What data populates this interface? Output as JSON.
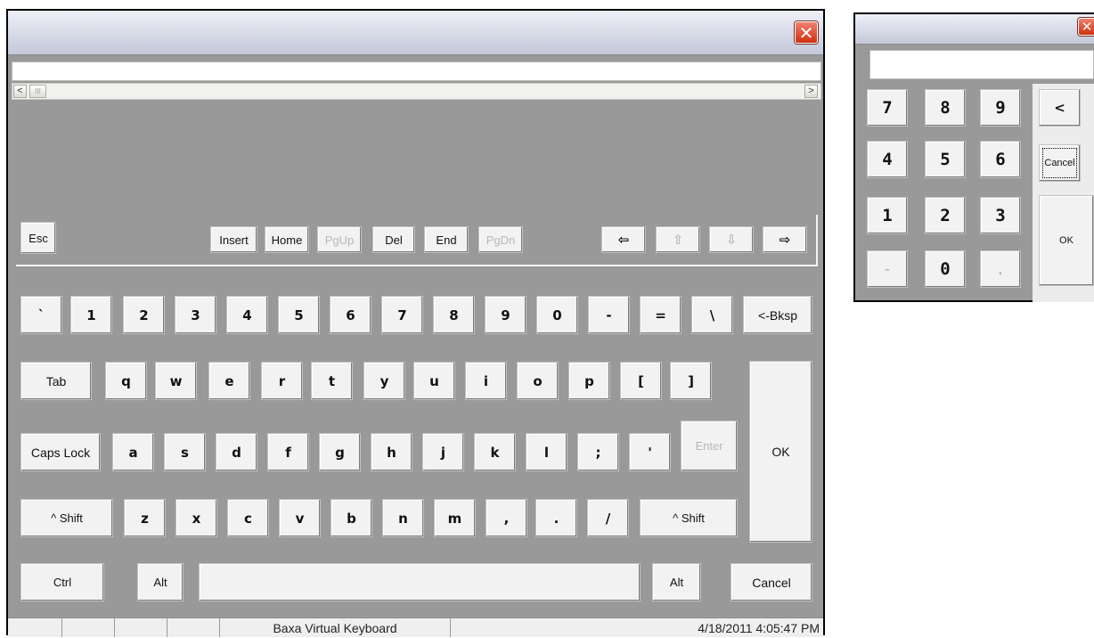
{
  "keyboard": {
    "close_icon": "close-x-icon",
    "text_value": "",
    "scroll_left": "<",
    "scroll_right": ">",
    "scroll_thumb": "III",
    "nav": {
      "esc": "Esc",
      "insert": "Insert",
      "home": "Home",
      "pgup": "PgUp",
      "del": "Del",
      "end": "End",
      "pgdn": "PgDn",
      "arrow_left": "⇦",
      "arrow_up": "⇧",
      "arrow_down": "⇩",
      "arrow_right": "⇨"
    },
    "row1": [
      "`",
      "1",
      "2",
      "3",
      "4",
      "5",
      "6",
      "7",
      "8",
      "9",
      "0",
      "-",
      "=",
      "\\",
      "<-Bksp"
    ],
    "row2": [
      "Tab",
      "q",
      "w",
      "e",
      "r",
      "t",
      "y",
      "u",
      "i",
      "o",
      "p",
      "[",
      "]"
    ],
    "row3": [
      "Caps Lock",
      "a",
      "s",
      "d",
      "f",
      "g",
      "h",
      "j",
      "k",
      "l",
      ";",
      "'",
      "Enter"
    ],
    "row4": [
      "^ Shift",
      "z",
      "x",
      "c",
      "v",
      "b",
      "n",
      "m",
      ",",
      ".",
      "/",
      "^ Shift"
    ],
    "row5": {
      "ctrl": "Ctrl",
      "alt_left": "Alt",
      "space": "",
      "alt_right": "Alt",
      "cancel": "Cancel"
    },
    "ok": "OK",
    "disabled_keys": [
      "PgUp",
      "PgDn",
      "⇧",
      "⇩",
      "Enter"
    ],
    "status": {
      "title": "Baxa Virtual Keyboard",
      "datetime": "4/18/2011 4:05:47 PM"
    }
  },
  "numpad": {
    "close_icon": "close-x-icon",
    "display_value": "",
    "keys": [
      [
        "7",
        "8",
        "9"
      ],
      [
        "4",
        "5",
        "6"
      ],
      [
        "1",
        "2",
        "3"
      ],
      [
        "-",
        "0",
        "."
      ]
    ],
    "disabled_keys": [
      "-",
      "."
    ],
    "backspace": "<",
    "cancel": "Cancel",
    "ok": "OK"
  },
  "colors": {
    "window_bg": "#999999",
    "key_face": "#f2f2f2",
    "disabled_text": "#b8b8b8",
    "close_red": "#e05030"
  }
}
